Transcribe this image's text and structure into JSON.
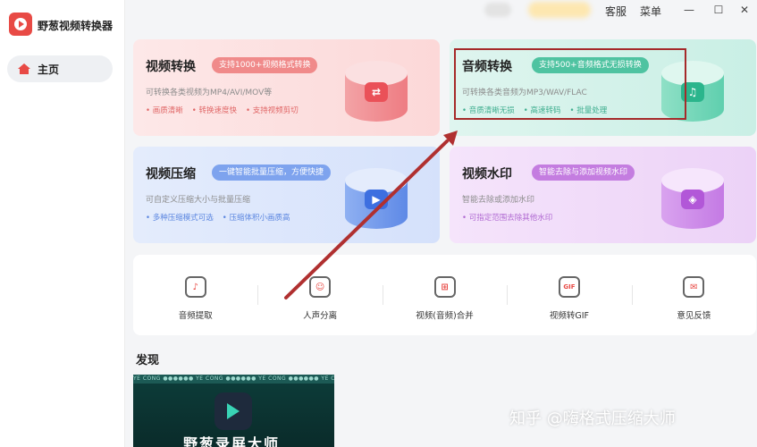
{
  "app": {
    "title": "野葱视频转换器"
  },
  "sidebar": {
    "home_label": "主页"
  },
  "topbar": {
    "service": "客服",
    "menu": "菜单",
    "minimize": "—",
    "maximize": "☐",
    "close": "✕"
  },
  "cards": [
    {
      "title": "视频转换",
      "tag": "支持1000+视频格式转换",
      "desc": "可转换各类视频为MP4/AVI/MOV等",
      "features": [
        "画质清晰",
        "转换速度快",
        "支持视频剪切"
      ],
      "icon": "video-convert-icon"
    },
    {
      "title": "音频转换",
      "tag": "支持500+音频格式无损转换",
      "desc": "可转换各类音频为MP3/WAV/FLAC",
      "features": [
        "音质清晰无损",
        "高速转码",
        "批量处理"
      ],
      "icon": "audio-convert-icon"
    },
    {
      "title": "视频压缩",
      "tag": "一键智能批量压缩，方便快捷",
      "desc": "可自定义压缩大小与批量压缩",
      "features": [
        "多种压缩模式可选",
        "压缩体积小画质高"
      ],
      "icon": "video-compress-icon"
    },
    {
      "title": "视频水印",
      "tag": "智能去除与添加视频水印",
      "desc": "智能去除或添加水印",
      "features": [
        "可指定范围去除其他水印"
      ],
      "icon": "video-watermark-icon"
    }
  ],
  "tools": [
    {
      "label": "音频提取",
      "icon": "audio-extract-icon",
      "glyph": "♪"
    },
    {
      "label": "人声分离",
      "icon": "vocal-separate-icon",
      "glyph": "☺"
    },
    {
      "label": "视频(音频)合并",
      "icon": "merge-icon",
      "glyph": "⊞"
    },
    {
      "label": "视频转GIF",
      "icon": "gif-icon",
      "glyph": "GIF"
    },
    {
      "label": "意见反馈",
      "icon": "feedback-icon",
      "glyph": "✉"
    }
  ],
  "discover": {
    "title": "发现",
    "promo_text": "野葱录屏大师",
    "promo_strip": "YE CONG ●●●●●● YE CONG ●●●●●● YE CONG ●●●●●● YE CONG ●●●●●●"
  },
  "watermark": "知乎 @嗨格式压缩大师",
  "colors": {
    "accent": "#e84a45",
    "highlight": "#a52a2a"
  }
}
